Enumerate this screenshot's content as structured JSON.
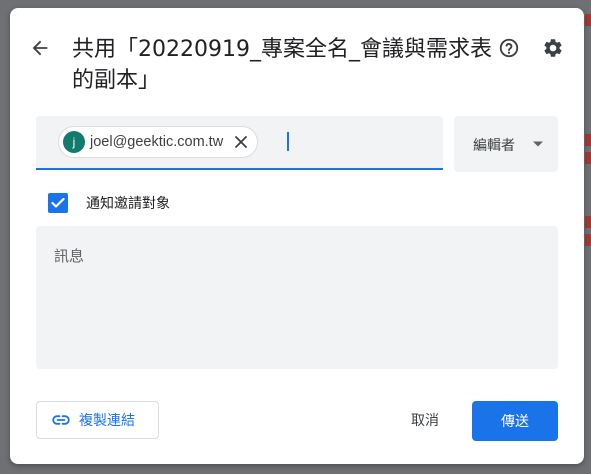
{
  "dialog": {
    "title": "共用「20220919_專案全名_會議與需求表 的副本」",
    "icons": {
      "back": "arrow-back-icon",
      "help": "help-circle-icon",
      "settings": "gear-icon"
    }
  },
  "recipients": {
    "chips": [
      {
        "avatar_letter": "j",
        "email": "joel@geektic.com.tw",
        "avatar_color": "#137a6e"
      }
    ]
  },
  "role": {
    "selected": "編輯者"
  },
  "notify": {
    "label": "通知邀請對象",
    "checked": true
  },
  "message": {
    "placeholder": "訊息"
  },
  "footer": {
    "copy_link_label": "複製連結",
    "cancel_label": "取消",
    "send_label": "傳送"
  },
  "colors": {
    "accent": "#1a73e8",
    "field_bg": "#f1f3f4",
    "text": "#202124"
  }
}
